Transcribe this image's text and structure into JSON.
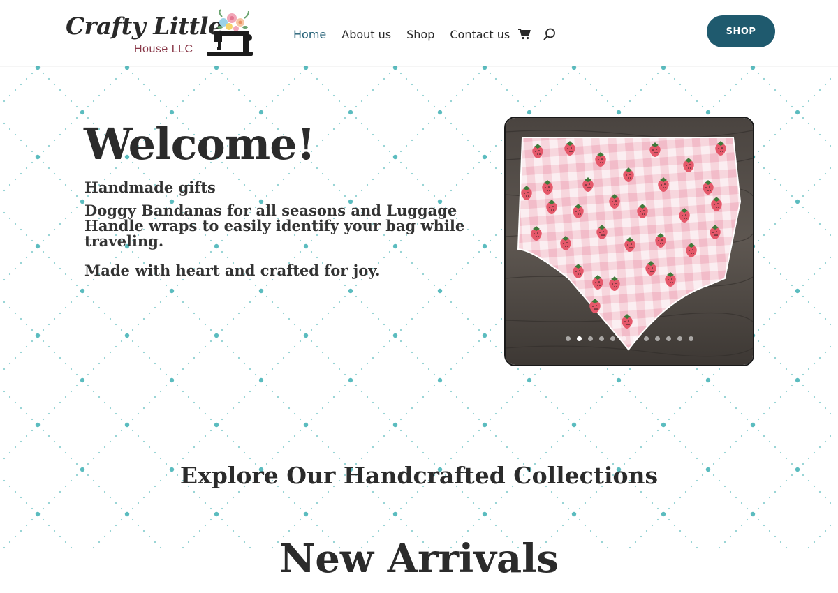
{
  "logo": {
    "script_text": "Crafty Little",
    "sub_text": "House LLC"
  },
  "nav": {
    "items": [
      {
        "label": "Home",
        "active": true
      },
      {
        "label": "About us",
        "active": false
      },
      {
        "label": "Shop",
        "active": false
      },
      {
        "label": "Contact us",
        "active": false
      }
    ],
    "cart_icon": "cart-icon",
    "search_icon": "search-icon"
  },
  "shop_button": {
    "label": "SHOP"
  },
  "hero": {
    "title": "Welcome!",
    "line1": "Handmade gifts",
    "line2": "Doggy Bandanas for all seasons and Luggage Handle wraps to easily identify your bag while traveling.",
    "line3": "Made with heart and crafted for joy."
  },
  "slider": {
    "slide_count": 12,
    "active_index": 1
  },
  "sections": {
    "collections_title": "Explore Our Handcrafted Collections",
    "new_arrivals_title": "New Arrivals"
  },
  "colors": {
    "accent": "#1f5a6e",
    "pattern_dot": "#5bbcbf",
    "bandana_pink": "#f6cfd8",
    "strawberry": "#e5586a"
  }
}
